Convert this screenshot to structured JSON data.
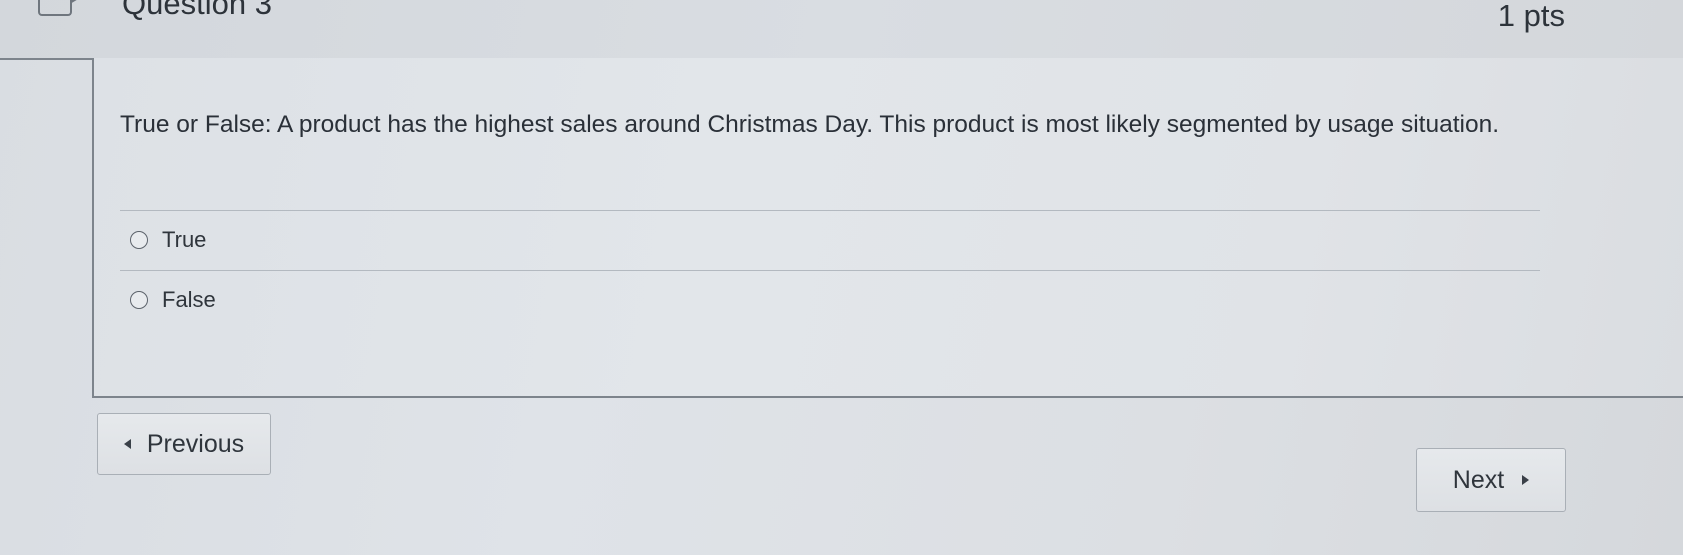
{
  "question": {
    "title": "Question 3",
    "points": "1 pts",
    "text": "True or False: A product has the highest sales around Christmas Day. This product is most likely segmented by usage situation.",
    "answers": [
      {
        "label": "True",
        "selected": false
      },
      {
        "label": "False",
        "selected": false
      }
    ]
  },
  "navigation": {
    "previous_label": "Previous",
    "next_label": "Next"
  }
}
